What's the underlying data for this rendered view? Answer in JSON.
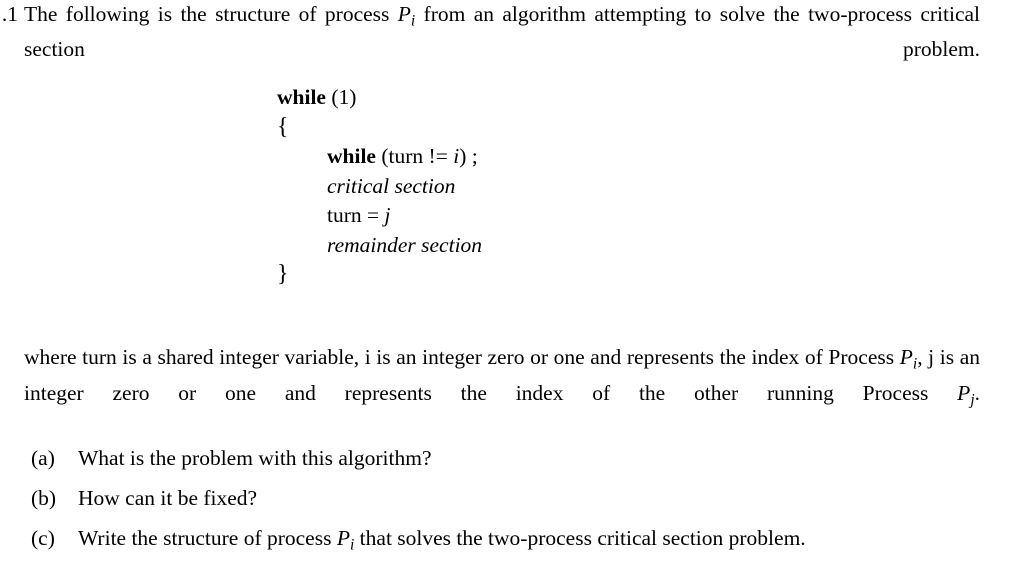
{
  "document": {
    "background_color": "#ffffff",
    "text_color": "#000000",
    "question_number": "1.",
    "stem": {
      "before_var": "The following is the structure of process ",
      "var_base": "P",
      "var_sub": "i",
      "after_var": " from an algorithm attempting to solve the two-process critical section problem."
    },
    "code": {
      "lines": [
        {
          "id": "while-outer",
          "indent": 0,
          "keyword": "while",
          "rest": " (1)",
          "style": "keyword"
        },
        {
          "id": "open-brace",
          "indent": 0,
          "keyword": "",
          "rest": "{",
          "style": "brace"
        },
        {
          "id": "while-inner",
          "indent": 1,
          "keyword": "while",
          "rest": " (turn != i) ;",
          "style": "keyword-italic-i"
        },
        {
          "id": "critical-section",
          "indent": 1,
          "keyword": "",
          "rest": "critical section",
          "style": "italic"
        },
        {
          "id": "turn-assign",
          "indent": 1,
          "keyword": "",
          "rest": "turn = j",
          "style": "roman-italic-j"
        },
        {
          "id": "remainder-section",
          "indent": 1,
          "keyword": "",
          "rest": "remainder section",
          "style": "italic"
        },
        {
          "id": "close-brace",
          "indent": 0,
          "keyword": "",
          "rest": "}",
          "style": "brace"
        }
      ],
      "line1_keyword": "while",
      "line1_rest": " (1)",
      "line2_text": "{",
      "line3_keyword": "while",
      "line3_open": " (turn !",
      "line3_eq": "= ",
      "line3_var": "i",
      "line3_close": ") ;",
      "line4_text": "critical section",
      "line5_pre": "turn = ",
      "line5_var": "j",
      "line6_text": "remainder section",
      "line7_text": "}"
    },
    "where_paragraph": {
      "seg1": "where turn is a shared integer variable, i is an integer zero or one and represents the index of Process ",
      "var1_base": "P",
      "var1_sub": "i",
      "seg2": ", j is an integer zero or one and represents the index of the other running Process ",
      "var2_base": "P",
      "var2_sub": "j",
      "seg3": "."
    },
    "questions": [
      {
        "marker": "(a)",
        "text": "What is the problem with this algorithm?"
      },
      {
        "marker": "(b)",
        "text": "How can it be fixed?"
      },
      {
        "marker": "(c)",
        "prefix": "Write the structure of process ",
        "var_base": "P",
        "var_sub": "i",
        "suffix": " that solves the two-process critical section problem."
      }
    ]
  }
}
